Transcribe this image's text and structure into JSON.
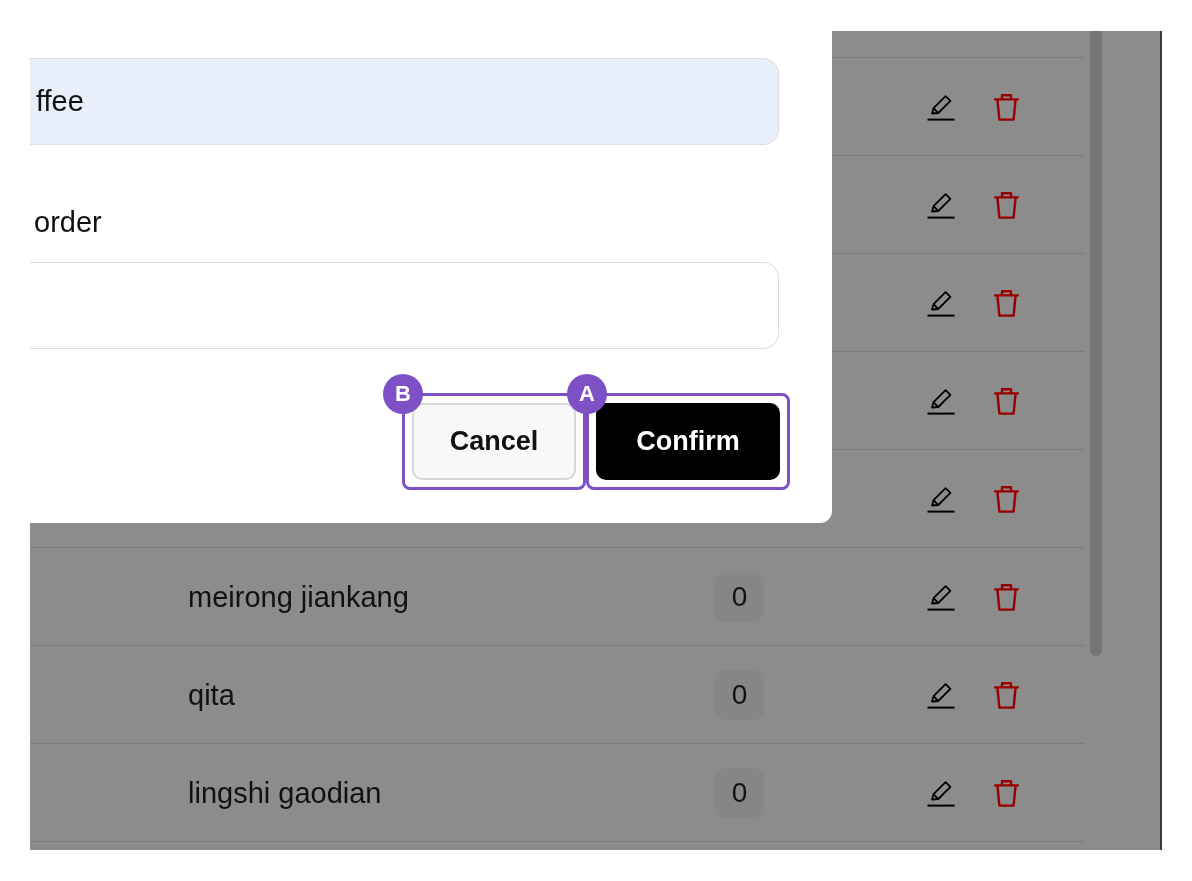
{
  "dialog": {
    "fields": [
      {
        "value": "ffee",
        "autofilled": true
      },
      {
        "label": "order",
        "autofilled": false
      }
    ],
    "buttons": [
      {
        "label": "Cancel",
        "kind": "secondary",
        "marker": "B"
      },
      {
        "label": "Confirm",
        "kind": "primary",
        "marker": "A"
      }
    ]
  },
  "table": {
    "rows": [
      {},
      {},
      {},
      {},
      {},
      {
        "name": "meirong jiankang",
        "count": "0"
      },
      {
        "name": "qita",
        "count": "0"
      },
      {
        "name": "lingshi gaodian",
        "count": "0"
      }
    ]
  }
}
